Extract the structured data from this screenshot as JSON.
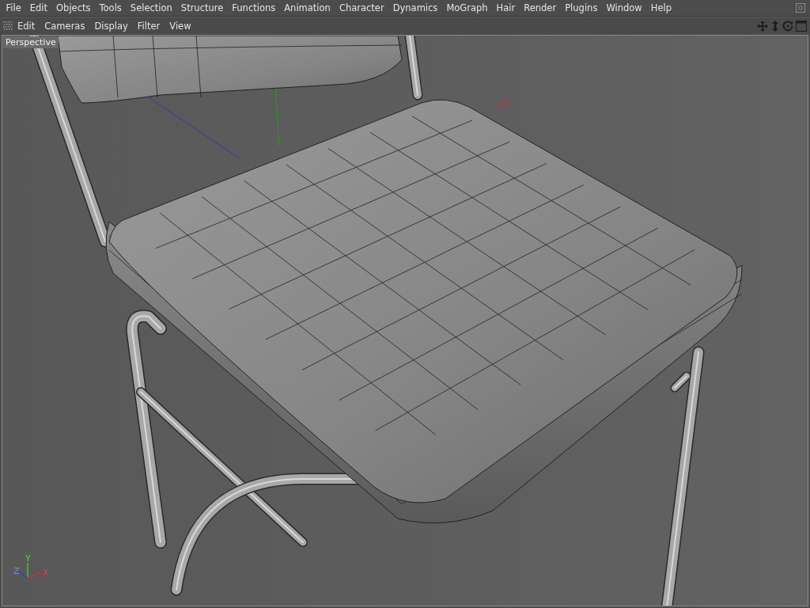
{
  "menu_bar": {
    "items": [
      "File",
      "Edit",
      "Objects",
      "Tools",
      "Selection",
      "Structure",
      "Functions",
      "Animation",
      "Character",
      "Dynamics",
      "MoGraph",
      "Hair",
      "Render",
      "Plugins",
      "Window",
      "Help"
    ]
  },
  "viewport_menu": {
    "items": [
      "Edit",
      "Cameras",
      "Display",
      "Filter",
      "View"
    ]
  },
  "viewport": {
    "label": "Perspective",
    "axis_labels": [
      "Z",
      "Y",
      "X"
    ]
  }
}
